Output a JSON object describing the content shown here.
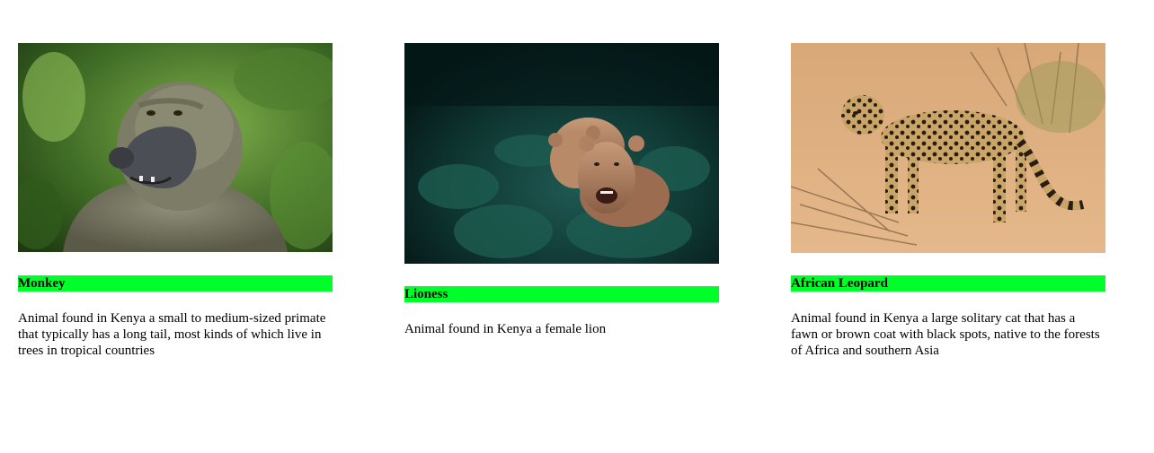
{
  "cards": [
    {
      "title": "Monkey",
      "description": "Animal found in Kenya a small to medium-sized primate that typically has a long tail, most kinds of which live in trees in tropical countries",
      "image": "baboon-photo"
    },
    {
      "title": "Lioness",
      "description": "Animal found in Kenya a female lion",
      "image": "lioness-photo"
    },
    {
      "title": "African Leopard",
      "description": "Animal found in Kenya a large solitary cat that has a fawn or brown coat with black spots, native to the forests of Africa and southern Asia",
      "image": "leopard-photo"
    }
  ],
  "colors": {
    "title_highlight": "#00ff2a",
    "text": "#000000",
    "background": "#ffffff"
  }
}
